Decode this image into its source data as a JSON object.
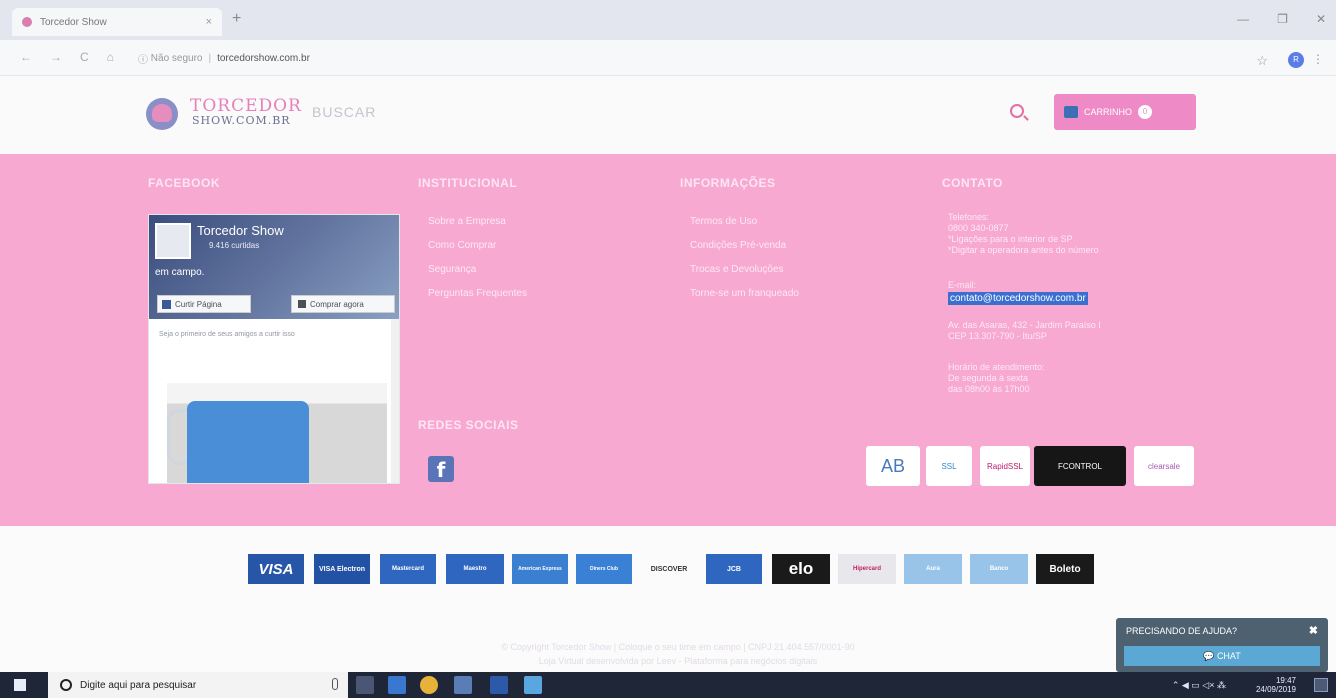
{
  "browser": {
    "tab_title": "Torcedor Show",
    "tab_close": "×",
    "new_tab": "+",
    "security": "Não seguro",
    "url": "torcedorshow.com.br",
    "profile_initial": "R"
  },
  "header": {
    "logo_line1": "TORCEDOR",
    "logo_line2": "SHOW.COM.BR",
    "search_placeholder": "BUSCAR",
    "cart_label": "CARRINHO",
    "cart_count": "0"
  },
  "footer": {
    "facebook": {
      "title": "FACEBOOK",
      "page_name": "Torcedor Show",
      "likes": "9.416 curtidas",
      "slogan": "em campo.",
      "like_button": "Curtir Página",
      "buy_button": "Comprar agora",
      "friends_text": "Seja o primeiro de seus amigos a curtir isso"
    },
    "institucional": {
      "title": "INSTITUCIONAL",
      "links": [
        "Sobre a Empresa",
        "Como Comprar",
        "Segurança",
        "Perguntas Frequentes"
      ]
    },
    "informacoes": {
      "title": "INFORMAÇÕES",
      "links": [
        "Termos de Uso",
        "Condições Pré-venda",
        "Trocas e Devoluções",
        "Torne-se um franqueado"
      ]
    },
    "contato": {
      "title": "CONTATO",
      "phones_label": "Telefones:",
      "phone": "0800 340-0877",
      "phone_note1": "*Ligações para o interior de SP",
      "phone_note2": "*Digitar a operadora antes do número",
      "email_label": "E-mail:",
      "email": "contato@torcedorshow.com.br",
      "address1": "Av. das Asaras, 432 - Jardim Paraíso I",
      "address2": "CEP 13.307-790 - Itu/SP",
      "hours_label": "Horário de atendimento:",
      "hours1": "De segunda à sexta",
      "hours2": "das 08h00 às 17h00"
    },
    "social_title": "REDES SOCIAIS",
    "seals": [
      "AB",
      "SSL",
      "RapidSSL",
      "FCONTROL",
      "clearsale"
    ],
    "payments": [
      "VISA",
      "VISA Electron",
      "Mastercard",
      "Maestro",
      "American Express",
      "Diners Club",
      "DISCOVER",
      "JCB",
      "elo",
      "Hipercard",
      "Aura",
      "Banco",
      "Boleto"
    ],
    "copyright_line1": "© Copyright Torcedor Show | Coloque o seu time em campo | CNPJ 21.404.557/0001-90",
    "copyright_line2": "Loja Virtual desenvolvida por Leev - Plataforma para negócios digitais"
  },
  "chat": {
    "title": "PRECISANDO DE AJUDA?",
    "close": "✖",
    "button": "CHAT"
  },
  "taskbar": {
    "search_placeholder": "Digite aqui para pesquisar",
    "time": "19:47",
    "date": "24/09/2019"
  },
  "colors": {
    "pink_band": "#f7a9d2",
    "brand_pink": "#ee8ac6",
    "chat_bg": "#4e6170"
  }
}
